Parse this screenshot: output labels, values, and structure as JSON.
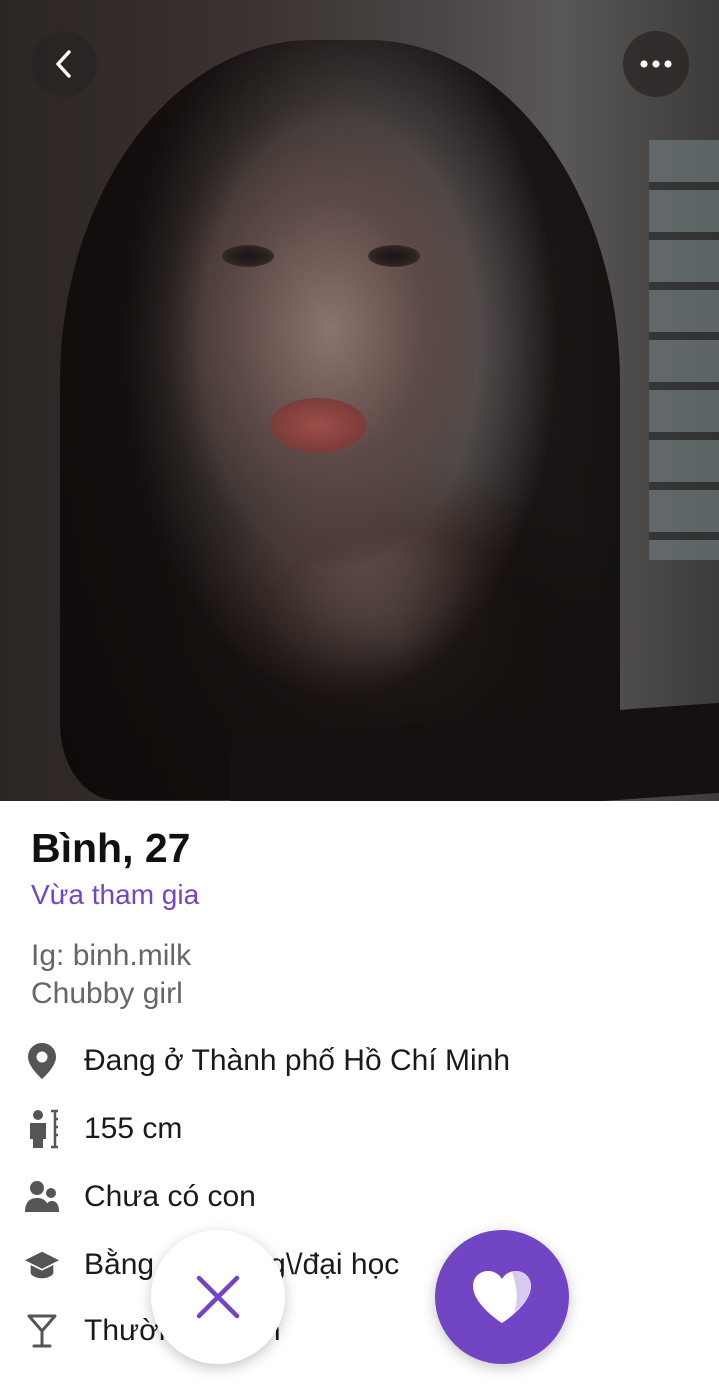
{
  "profile": {
    "name_age": "Bình, 27",
    "status": "Vừa tham gia",
    "bio_lines": [
      "Ig: binh.milk",
      "Chubby girl"
    ]
  },
  "details": [
    {
      "icon": "location-pin-icon",
      "text": "Đang ở Thành phố Hồ Chí Minh"
    },
    {
      "icon": "height-icon",
      "text": "155 cm"
    },
    {
      "icon": "people-icon",
      "text": "Chưa có con"
    },
    {
      "icon": "education-icon",
      "text": "Bằng cao đẳng\\/đại học"
    },
    {
      "icon": "cocktail-icon",
      "text": "Thường xuyên"
    }
  ],
  "colors": {
    "accent": "#7245c4",
    "icon_gray": "#555555",
    "text_dark": "#1a1a1a",
    "text_muted": "#666666"
  },
  "icons": {
    "back": "chevron-left-icon",
    "more": "more-dots-icon",
    "dislike": "close-icon",
    "like": "heart-icon"
  }
}
